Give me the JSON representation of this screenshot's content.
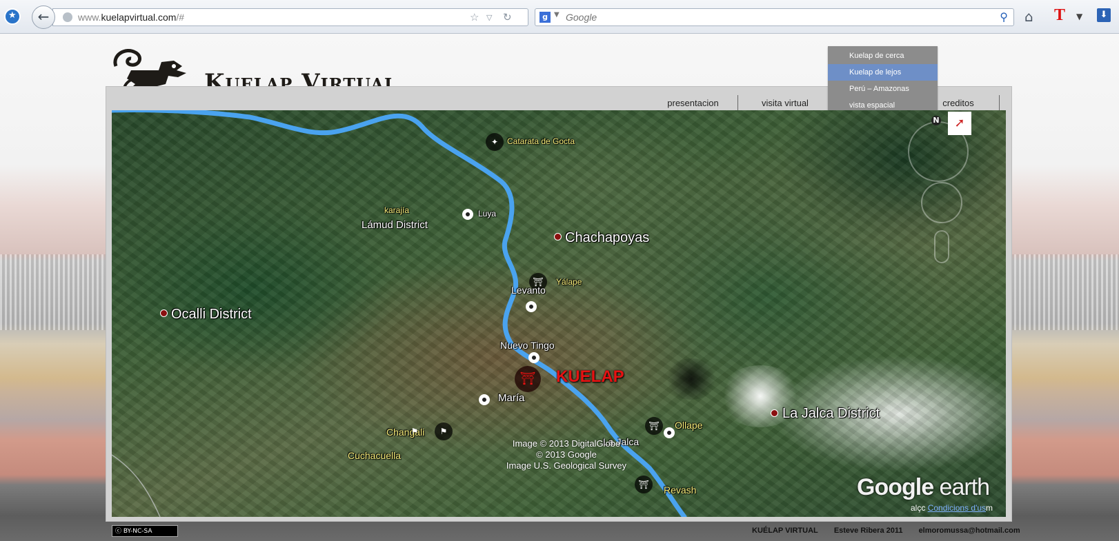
{
  "browser": {
    "url_prefix": "www.",
    "url_domain": "kuelapvirtual.com",
    "url_suffix": "/#",
    "search_engine_letter": "g",
    "search_placeholder": "Google"
  },
  "site": {
    "title": "Kuelap Virtual"
  },
  "nav": {
    "items": [
      "presentacion",
      "visita virtual",
      "creditos"
    ],
    "dropdown": [
      "Kuelap de cerca",
      "Kuelap de lejos",
      "Perú – Amazonas",
      "vista espacial"
    ],
    "dropdown_active_index": 1
  },
  "map": {
    "labels": {
      "catarata": "Catarata de Gocta",
      "karajia": "karajía",
      "luya": "Luya",
      "lamud": "Lámud District",
      "chachapoyas": "Chachapoyas",
      "yalape": "Yálape",
      "levanto": "Levanto",
      "ocalli": "Ocalli District",
      "nuevo_tingo": "Nuevo Tingo",
      "kuelap": "KUELAP",
      "maria": "María",
      "ollape": "Ollape",
      "la_jalca_district": "La Jalca District",
      "changali": "Changali",
      "cuchacuella": "Cuchacuella",
      "la_jalca": "La Jalca",
      "revash": "Revash"
    },
    "attribution": [
      "Image © 2013 DigitalGlobe",
      "© 2013 Google",
      "Image U.S. Geological Survey"
    ],
    "logo_bold": "Google",
    "logo_light": " earth",
    "terms_prefix": "alçc",
    "terms_link": "Condicions d'us",
    "terms_suffix": "m",
    "compass": "N"
  },
  "footer": {
    "license": "BY-NC-SA",
    "site": "KUÉLAP VIRTUAL",
    "author": "Esteve Ribera 2011",
    "email": "elmoromussa@hotmail.com"
  },
  "colors": {
    "river": "#4aa3ef",
    "kuelap_red": "#e51212",
    "dropdown_bg": "#8c8c8c",
    "dropdown_active": "#6e8fc7"
  }
}
